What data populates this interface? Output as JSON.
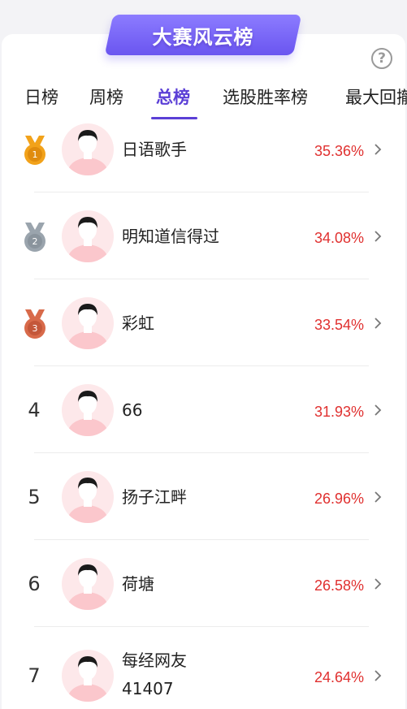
{
  "banner": {
    "title": "大赛风云榜"
  },
  "help": {
    "label": "?"
  },
  "tabs": [
    {
      "label": "日榜",
      "active": false
    },
    {
      "label": "周榜",
      "active": false
    },
    {
      "label": "总榜",
      "active": true
    },
    {
      "label": "选股胜率榜",
      "active": false
    },
    {
      "label": "最大回撤",
      "active": false
    }
  ],
  "colors": {
    "accent": "#5b3fd6",
    "rate": "#e0302f",
    "gold": "#f2a21a",
    "silver": "#9aa4ad",
    "bronze": "#d86a4a"
  },
  "rows": [
    {
      "rank": "1",
      "medal": "gold",
      "name": "日语歌手",
      "rate": "35.36%"
    },
    {
      "rank": "2",
      "medal": "silver",
      "name": "明知道信得过",
      "rate": "34.08%"
    },
    {
      "rank": "3",
      "medal": "bronze",
      "name": "彩虹",
      "rate": "33.54%"
    },
    {
      "rank": "4",
      "medal": "",
      "name": "66",
      "rate": "31.93%"
    },
    {
      "rank": "5",
      "medal": "",
      "name": "扬子江畔",
      "rate": "26.96%"
    },
    {
      "rank": "6",
      "medal": "",
      "name": "荷塘",
      "rate": "26.58%"
    },
    {
      "rank": "7",
      "medal": "",
      "name": "每经网友41407",
      "name_line1": "每经网友",
      "name_line2": "41407",
      "rate": "24.64%"
    }
  ]
}
